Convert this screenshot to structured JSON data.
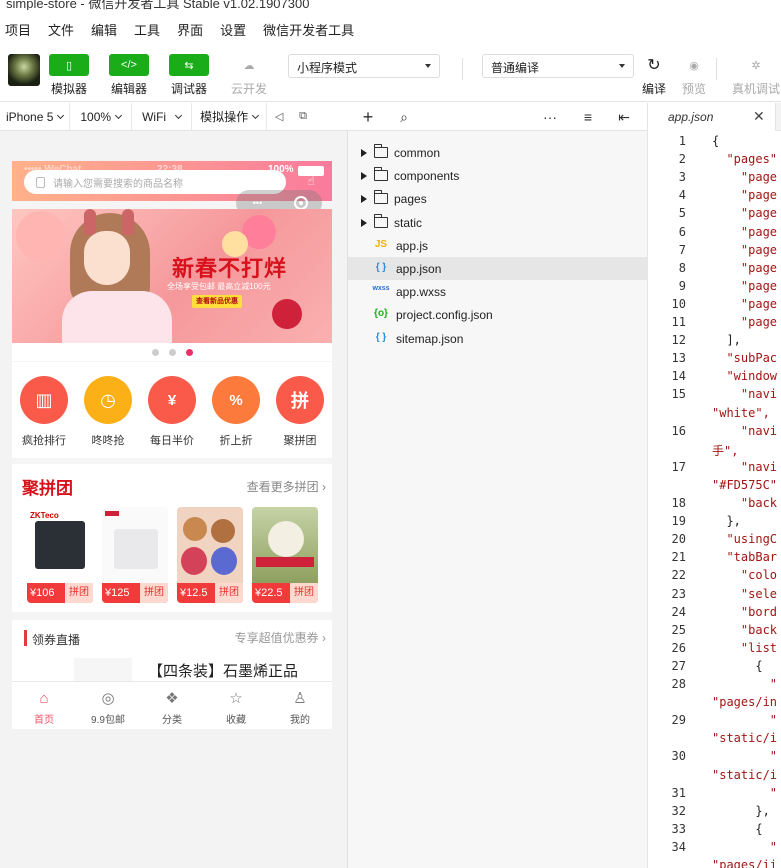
{
  "window": {
    "title": "simple-store - 微信开发者工具 Stable v1.02.1907300"
  },
  "menu": [
    "项目",
    "文件",
    "编辑",
    "工具",
    "界面",
    "设置",
    "微信开发者工具"
  ],
  "toolbar": {
    "simulator": "模拟器",
    "editor": "编辑器",
    "debugger": "调试器",
    "cloud": "云开发",
    "mode": "小程序模式",
    "compile_mode": "普通编译",
    "compile": "编译",
    "preview": "预览",
    "remote_debug": "真机调试"
  },
  "device": {
    "model": "iPhone 5",
    "zoom": "100%",
    "network": "WiFi",
    "sim_ops": "模拟操作"
  },
  "phone": {
    "search_placeholder": "请输入您需要搜索的商品名称",
    "banner_title": "新春不打烊",
    "banner_sub": "全场享受包邮 最高立减100元",
    "banner_btn": "查看新品优惠",
    "categories": [
      {
        "name": "疯抢排行",
        "color": "#fa5a4a"
      },
      {
        "name": "咚咚抢",
        "color": "#fbb017"
      },
      {
        "name": "每日半价",
        "color": "#fa5a4a"
      },
      {
        "name": "折上折",
        "color": "#fb7a3c"
      },
      {
        "name": "聚拼团",
        "color": "#fa5a4a"
      }
    ],
    "group": {
      "title": "聚拼团",
      "more": "查看更多拼团 ›",
      "items": [
        {
          "price": "¥106",
          "tag": "拼团",
          "color": "#2b2f36"
        },
        {
          "price": "¥125",
          "tag": "拼团",
          "color": "#e9e9ec"
        },
        {
          "price": "¥12.5",
          "tag": "拼团",
          "color": "#d9a06a"
        },
        {
          "price": "¥22.5",
          "tag": "拼团",
          "color": "#9fb078"
        }
      ]
    },
    "live": {
      "title": "领券直播",
      "more": "专享超值优惠券 ›",
      "product": "【四条装】石墨烯正品"
    },
    "tabs": [
      "首页",
      "9.9包邮",
      "分类",
      "收藏",
      "我的"
    ]
  },
  "explorer": {
    "folders": [
      "common",
      "components",
      "pages",
      "static"
    ],
    "files": [
      {
        "name": "app.js",
        "icon": "JS",
        "color": "#e8b600"
      },
      {
        "name": "app.json",
        "icon": "{ }",
        "color": "#2a8fd6"
      },
      {
        "name": "app.wxss",
        "icon": "wxss",
        "color": "#2a6fd6"
      },
      {
        "name": "project.config.json",
        "icon": "{o}",
        "color": "#1aad19"
      },
      {
        "name": "sitemap.json",
        "icon": "{ }",
        "color": "#2a8fd6"
      }
    ]
  },
  "editor": {
    "tab": "app.json",
    "lines": [
      {
        "n": "1",
        "t": "{"
      },
      {
        "n": "2",
        "t": "  \"pages\""
      },
      {
        "n": "3",
        "t": "    \"page"
      },
      {
        "n": "4",
        "t": "    \"page"
      },
      {
        "n": "5",
        "t": "    \"page"
      },
      {
        "n": "6",
        "t": "    \"page"
      },
      {
        "n": "7",
        "t": "    \"page"
      },
      {
        "n": "8",
        "t": "    \"page"
      },
      {
        "n": "9",
        "t": "    \"page"
      },
      {
        "n": "10",
        "t": "    \"page"
      },
      {
        "n": "11",
        "t": "    \"page"
      },
      {
        "n": "12",
        "t": "  ],"
      },
      {
        "n": "13",
        "t": "  \"subPac"
      },
      {
        "n": "14",
        "t": "  \"window"
      },
      {
        "n": "15",
        "t": "    \"navi"
      },
      {
        "n": "",
        "t": "\"white\","
      },
      {
        "n": "16",
        "t": "    \"navi"
      },
      {
        "n": "",
        "t": "手\","
      },
      {
        "n": "17",
        "t": "    \"navi"
      },
      {
        "n": "",
        "t": "\"#FD575C\""
      },
      {
        "n": "18",
        "t": "    \"back"
      },
      {
        "n": "19",
        "t": "  },"
      },
      {
        "n": "20",
        "t": "  \"usingC"
      },
      {
        "n": "21",
        "t": "  \"tabBar"
      },
      {
        "n": "22",
        "t": "    \"colo"
      },
      {
        "n": "23",
        "t": "    \"sele"
      },
      {
        "n": "24",
        "t": "    \"bord"
      },
      {
        "n": "25",
        "t": "    \"back"
      },
      {
        "n": "26",
        "t": "    \"list"
      },
      {
        "n": "27",
        "t": "      {"
      },
      {
        "n": "28",
        "t": "        \""
      },
      {
        "n": "",
        "t": "\"pages/in"
      },
      {
        "n": "29",
        "t": "        \""
      },
      {
        "n": "",
        "t": "\"static/i"
      },
      {
        "n": "30",
        "t": "        \""
      },
      {
        "n": "",
        "t": "\"static/i"
      },
      {
        "n": "31",
        "t": "        \""
      },
      {
        "n": "32",
        "t": "      },"
      },
      {
        "n": "33",
        "t": "      {"
      },
      {
        "n": "34",
        "t": "        \""
      },
      {
        "n": "",
        "t": "\"pages/ii"
      }
    ]
  }
}
